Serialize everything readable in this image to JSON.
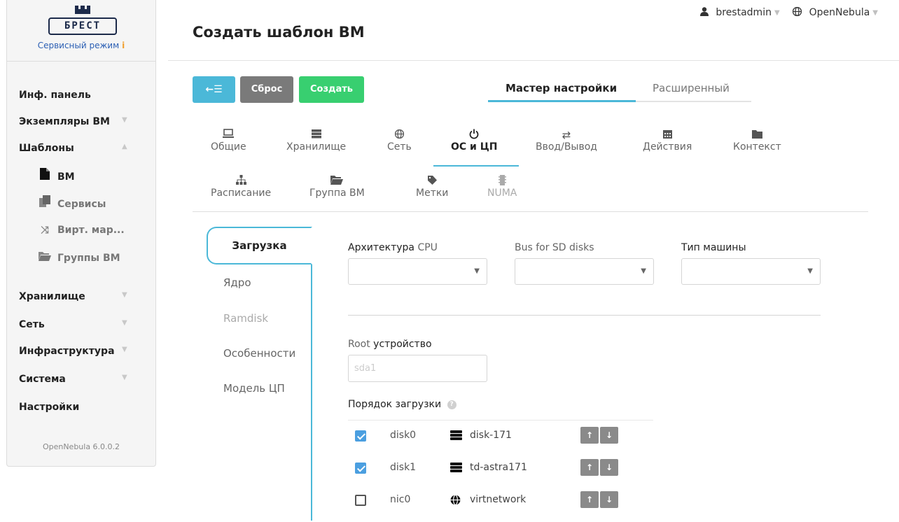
{
  "sidebar": {
    "logo_text": "БРЕСТ",
    "service_mode": "Сервисный режим",
    "service_mode_info": "i",
    "items": {
      "dashboard": "Инф. панель",
      "vms": "Экземпляры ВМ",
      "templates": "Шаблоны",
      "vm": "ВМ",
      "services": "Сервисы",
      "vrouters": "Вирт. мар...",
      "vm_groups": "Группы ВМ",
      "storage": "Хранилище",
      "network": "Сеть",
      "infrastructure": "Инфраструктура",
      "system": "Система",
      "settings": "Настройки"
    },
    "version": "OpenNebula 6.0.0.2"
  },
  "topbar": {
    "user": "brestadmin",
    "zone": "OpenNebula"
  },
  "page_title": "Создать шаблон ВМ",
  "actions": {
    "back": "←☰",
    "reset": "Сброс",
    "create": "Создать"
  },
  "modes": {
    "wizard": "Мастер настройки",
    "advanced": "Расширенный"
  },
  "section_tabs": {
    "general": "Общие",
    "storage": "Хранилище",
    "network": "Сеть",
    "os_cpu": "ОС и ЦП",
    "io": "Ввод/Вывод",
    "actions": "Действия",
    "context": "Контекст",
    "scheduling": "Расписание",
    "vm_group": "Группа ВМ",
    "tags": "Метки",
    "numa": "NUMA"
  },
  "vertical_tabs": {
    "boot": "Загрузка",
    "kernel": "Ядро",
    "ramdisk": "Ramdisk",
    "features": "Особенности",
    "cpu_model": "Модель ЦП"
  },
  "form": {
    "arch_label_a": "Архитектура",
    "arch_label_b": "CPU",
    "bus_label": "Bus for SD disks",
    "machine_label": "Тип машины",
    "root_label_a": "Root",
    "root_label_b": "устройство",
    "root_placeholder": "sda1",
    "boot_order_label": "Порядок загрузки",
    "help": "?"
  },
  "boot_order": [
    {
      "id": "disk0",
      "name": "disk-171",
      "checked": true
    },
    {
      "id": "disk1",
      "name": "td-astra171",
      "checked": true
    },
    {
      "id": "nic0",
      "name": "virtnetwork",
      "checked": false
    }
  ],
  "arrows": {
    "up": "↑",
    "down": "↓"
  }
}
